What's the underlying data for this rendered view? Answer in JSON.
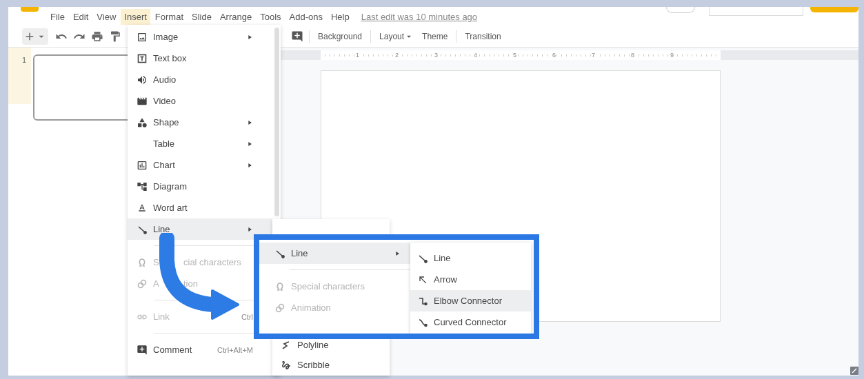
{
  "menu_bar": {
    "items": [
      {
        "label": "File",
        "selected": false
      },
      {
        "label": "Edit",
        "selected": false
      },
      {
        "label": "View",
        "selected": false
      },
      {
        "label": "Insert",
        "selected": true
      },
      {
        "label": "Format",
        "selected": false
      },
      {
        "label": "Slide",
        "selected": false
      },
      {
        "label": "Arrange",
        "selected": false
      },
      {
        "label": "Tools",
        "selected": false
      },
      {
        "label": "Add-ons",
        "selected": false
      },
      {
        "label": "Help",
        "selected": false
      }
    ],
    "last_edit": "Last edit was 10 minutes ago"
  },
  "toolbar": {
    "buttons": [
      {
        "label": "Background",
        "dropdown": false
      },
      {
        "label": "Layout",
        "dropdown": true
      },
      {
        "label": "Theme",
        "dropdown": false
      },
      {
        "label": "Transition",
        "dropdown": false
      }
    ]
  },
  "ruler": {
    "marks": [
      "1",
      "2",
      "3",
      "4",
      "5",
      "6",
      "7",
      "8",
      "9"
    ]
  },
  "filmstrip": {
    "slides": [
      {
        "number": "1",
        "selected": true
      }
    ]
  },
  "insert_menu": {
    "items": [
      {
        "kind": "item",
        "label": "Image",
        "submenu": true,
        "disabled": false,
        "highlighted": false
      },
      {
        "kind": "item",
        "label": "Text box",
        "submenu": false,
        "disabled": false,
        "highlighted": false
      },
      {
        "kind": "item",
        "label": "Audio",
        "submenu": false,
        "disabled": false,
        "highlighted": false
      },
      {
        "kind": "item",
        "label": "Video",
        "submenu": false,
        "disabled": false,
        "highlighted": false
      },
      {
        "kind": "item",
        "label": "Shape",
        "submenu": true,
        "disabled": false,
        "highlighted": false
      },
      {
        "kind": "item",
        "label": "Table",
        "submenu": true,
        "disabled": false,
        "highlighted": false
      },
      {
        "kind": "item",
        "label": "Chart",
        "submenu": true,
        "disabled": false,
        "highlighted": false
      },
      {
        "kind": "item",
        "label": "Diagram",
        "submenu": false,
        "disabled": false,
        "highlighted": false
      },
      {
        "kind": "item",
        "label": "Word art",
        "submenu": false,
        "disabled": false,
        "highlighted": false
      },
      {
        "kind": "item",
        "label": "Line",
        "submenu": true,
        "disabled": false,
        "highlighted": true
      },
      {
        "kind": "separator"
      },
      {
        "kind": "item",
        "label_parts": [
          "S",
          "cial characters"
        ],
        "submenu": false,
        "disabled": true,
        "highlighted": false
      },
      {
        "kind": "item",
        "label_parts": [
          "A",
          "tion"
        ],
        "submenu": false,
        "disabled": true,
        "highlighted": false
      },
      {
        "kind": "separator"
      },
      {
        "kind": "item",
        "label": "Link",
        "shortcut": "Ctrl",
        "submenu": false,
        "disabled": true,
        "highlighted": false
      },
      {
        "kind": "separator"
      },
      {
        "kind": "item",
        "label": "Comment",
        "shortcut": "Ctrl+Alt+M",
        "submenu": false,
        "disabled": false,
        "highlighted": false
      }
    ]
  },
  "line_submenu": {
    "items": [
      {
        "kind": "item",
        "label": "Polyline",
        "submenu": false,
        "disabled": false,
        "highlighted": false
      },
      {
        "kind": "item",
        "label": "Scribble",
        "submenu": false,
        "disabled": false,
        "highlighted": false
      }
    ]
  },
  "callout": {
    "menu": {
      "items": [
        {
          "kind": "item",
          "label": "Line",
          "submenu": true,
          "disabled": false,
          "highlighted": true
        },
        {
          "kind": "separator"
        },
        {
          "kind": "item",
          "label": "Special characters",
          "submenu": false,
          "disabled": true,
          "highlighted": false
        },
        {
          "kind": "item",
          "label": "Animation",
          "submenu": false,
          "disabled": true,
          "highlighted": false
        }
      ]
    },
    "submenu": {
      "items": [
        {
          "kind": "item",
          "label": "Line",
          "submenu": false,
          "disabled": false,
          "highlighted": false
        },
        {
          "kind": "item",
          "label": "Arrow",
          "submenu": false,
          "disabled": false,
          "highlighted": false
        },
        {
          "kind": "item",
          "label": "Elbow Connector",
          "submenu": false,
          "disabled": false,
          "highlighted": true
        },
        {
          "kind": "item",
          "label": "Curved Connector",
          "submenu": false,
          "disabled": false,
          "highlighted": false
        }
      ]
    }
  }
}
